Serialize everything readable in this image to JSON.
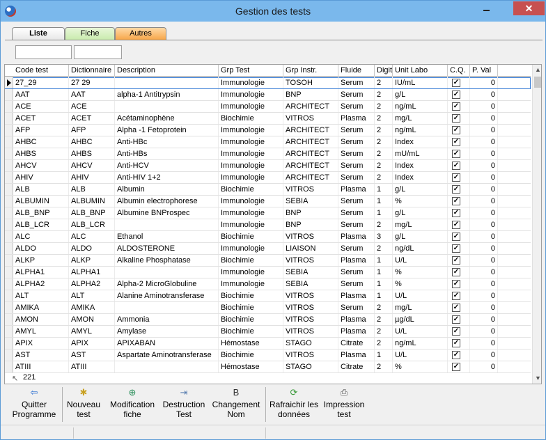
{
  "window": {
    "title": "Gestion des tests"
  },
  "tabs": [
    "Liste",
    "Fiche",
    "Autres"
  ],
  "filters": [
    {
      "value": ""
    },
    {
      "value": ""
    }
  ],
  "columns": [
    "Code test",
    "Dictionnaire",
    "Description",
    "Grp Test",
    "Grp Instr.",
    "Fluide",
    "Digit",
    "Unit Labo",
    "C.Q.",
    "P. Val"
  ],
  "rows": [
    [
      "27_29",
      "27 29",
      "",
      "Immunologie",
      "TOSOH",
      "Serum",
      "2",
      "IU/mL",
      true,
      "0"
    ],
    [
      "AAT",
      "AAT",
      "alpha-1 Antitrypsin",
      "Immunologie",
      "BNP",
      "Serum",
      "2",
      "g/L",
      true,
      "0"
    ],
    [
      "ACE",
      "ACE",
      "",
      "Immunologie",
      "ARCHITECT",
      "Serum",
      "2",
      "ng/mL",
      true,
      "0"
    ],
    [
      "ACET",
      "ACET",
      "Acétaminophène",
      "Biochimie",
      "VITROS",
      "Plasma",
      "2",
      "mg/L",
      true,
      "0"
    ],
    [
      "AFP",
      "AFP",
      "Alpha -1 Fetoprotein",
      "Immunologie",
      "ARCHITECT",
      "Serum",
      "2",
      "ng/mL",
      true,
      "0"
    ],
    [
      "AHBC",
      "AHBC",
      "Anti-HBc",
      "Immunologie",
      "ARCHITECT",
      "Serum",
      "2",
      "Index",
      true,
      "0"
    ],
    [
      "AHBS",
      "AHBS",
      "Anti-HBs",
      "Immunologie",
      "ARCHITECT",
      "Serum",
      "2",
      "mU/mL",
      true,
      "0"
    ],
    [
      "AHCV",
      "AHCV",
      "Anti-HCV",
      "Immunologie",
      "ARCHITECT",
      "Serum",
      "2",
      "Index",
      true,
      "0"
    ],
    [
      "AHIV",
      "AHIV",
      "Anti-HIV 1+2",
      "Immunologie",
      "ARCHITECT",
      "Serum",
      "2",
      "Index",
      true,
      "0"
    ],
    [
      "ALB",
      "ALB",
      "Albumin",
      "Biochimie",
      "VITROS",
      "Plasma",
      "1",
      "g/L",
      true,
      "0"
    ],
    [
      "ALBUMIN",
      "ALBUMIN",
      "Albumin electrophorese",
      "Immunologie",
      "SEBIA",
      "Serum",
      "1",
      "%",
      true,
      "0"
    ],
    [
      "ALB_BNP",
      "ALB_BNP",
      "Albumine BNProspec",
      "Immunologie",
      "BNP",
      "Serum",
      "1",
      "g/L",
      true,
      "0"
    ],
    [
      "ALB_LCR",
      "ALB_LCR",
      "",
      "Immunologie",
      "BNP",
      "Serum",
      "2",
      "mg/L",
      true,
      "0"
    ],
    [
      "ALC",
      "ALC",
      "Ethanol",
      "Biochimie",
      "VITROS",
      "Plasma",
      "3",
      "g/L",
      true,
      "0"
    ],
    [
      "ALDO",
      "ALDO",
      "ALDOSTERONE",
      "Immunologie",
      "LIAISON",
      "Serum",
      "2",
      "ng/dL",
      true,
      "0"
    ],
    [
      "ALKP",
      "ALKP",
      "Alkaline Phosphatase",
      "Biochimie",
      "VITROS",
      "Plasma",
      "1",
      "U/L",
      true,
      "0"
    ],
    [
      "ALPHA1",
      "ALPHA1",
      "",
      "Immunologie",
      "SEBIA",
      "Serum",
      "1",
      "%",
      true,
      "0"
    ],
    [
      "ALPHA2",
      "ALPHA2",
      "Alpha-2 MicroGlobuline",
      "Immunologie",
      "SEBIA",
      "Serum",
      "1",
      "%",
      true,
      "0"
    ],
    [
      "ALT",
      "ALT",
      "Alanine Aminotransferase",
      "Biochimie",
      "VITROS",
      "Plasma",
      "1",
      "U/L",
      true,
      "0"
    ],
    [
      "AMIKA",
      "AMIKA",
      "",
      "Biochimie",
      "VITROS",
      "Serum",
      "2",
      "mg/L",
      true,
      "0"
    ],
    [
      "AMON",
      "AMON",
      "Ammonia",
      "Biochimie",
      "VITROS",
      "Plasma",
      "2",
      "µg/dL",
      true,
      "0"
    ],
    [
      "AMYL",
      "AMYL",
      "Amylase",
      "Biochimie",
      "VITROS",
      "Plasma",
      "2",
      "U/L",
      true,
      "0"
    ],
    [
      "APIX",
      "APIX",
      "APIXABAN",
      "Hémostase",
      "STAGO",
      "Citrate",
      "2",
      "ng/mL",
      true,
      "0"
    ],
    [
      "AST",
      "AST",
      "Aspartate Aminotransferase",
      "Biochimie",
      "VITROS",
      "Plasma",
      "1",
      "U/L",
      true,
      "0"
    ],
    [
      "ATIII",
      "ATIII",
      "",
      "Hémostase",
      "STAGO",
      "Citrate",
      "2",
      "%",
      true,
      "0"
    ]
  ],
  "record_count": "221",
  "toolbar": [
    {
      "label1": "Quitter",
      "label2": "Programme",
      "icon": "exit-arrow-icon",
      "glyph": "⇦",
      "color": "#2a6fd1"
    },
    {
      "label1": "Nouveau",
      "label2": "test",
      "icon": "new-document-icon",
      "glyph": "✱",
      "color": "#c8a020"
    },
    {
      "label1": "Modification",
      "label2": "fiche",
      "icon": "magnifier-edit-icon",
      "glyph": "⊕",
      "color": "#2a8f5a"
    },
    {
      "label1": "Destruction",
      "label2": "Test",
      "icon": "delete-arrow-icon",
      "glyph": "⇥",
      "color": "#5a7fb0"
    },
    {
      "label1": "Changement",
      "label2": "Nom",
      "icon": "bold-b-icon",
      "glyph": "B",
      "color": "#333333"
    },
    {
      "label1": "Rafraichir les",
      "label2": "données",
      "icon": "refresh-icon",
      "glyph": "⟳",
      "color": "#3a9a3a"
    },
    {
      "label1": "Impression",
      "label2": "test",
      "icon": "printer-icon",
      "glyph": "⎙",
      "color": "#555555"
    }
  ]
}
